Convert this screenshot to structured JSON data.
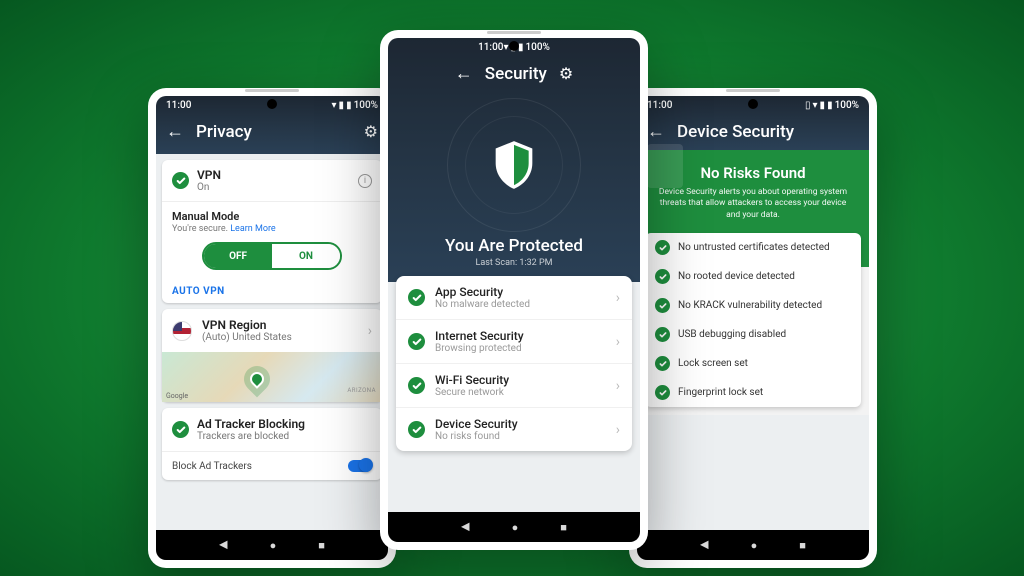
{
  "left": {
    "time": "11:00",
    "battery": "100%",
    "title": "Privacy",
    "vpn": {
      "title": "VPN",
      "status": "On"
    },
    "manual": {
      "title": "Manual Mode",
      "sub_prefix": "You're secure.",
      "learn_more": "Learn More"
    },
    "toggle": {
      "off": "OFF",
      "on": "ON"
    },
    "auto_vpn": "AUTO VPN",
    "region": {
      "title": "VPN Region",
      "sub": "(Auto) United States"
    },
    "map": {
      "attribution": "Google",
      "state": "ARIZONA"
    },
    "ad": {
      "title": "Ad Tracker Blocking",
      "sub": "Trackers are blocked"
    },
    "block_row": "Block Ad Trackers"
  },
  "center": {
    "time": "11:00",
    "battery": "100%",
    "title": "Security",
    "protected": "You Are Protected",
    "last_scan": "Last Scan: 1:32 PM",
    "rows": [
      {
        "title": "App Security",
        "sub": "No malware detected"
      },
      {
        "title": "Internet Security",
        "sub": "Browsing protected"
      },
      {
        "title": "Wi-Fi Security",
        "sub": "Secure network"
      },
      {
        "title": "Device Security",
        "sub": "No risks found"
      }
    ]
  },
  "right": {
    "time": "11:00",
    "battery": "100%",
    "title": "Device Security",
    "banner": {
      "heading": "No Risks Found",
      "sub": "Device Security alerts you about operating system threats that allow attackers to access your device and your data."
    },
    "items": [
      "No untrusted certificates detected",
      "No rooted device detected",
      "No KRACK vulnerability detected",
      "USB debugging disabled",
      "Lock screen set",
      "Fingerprint lock set"
    ]
  }
}
